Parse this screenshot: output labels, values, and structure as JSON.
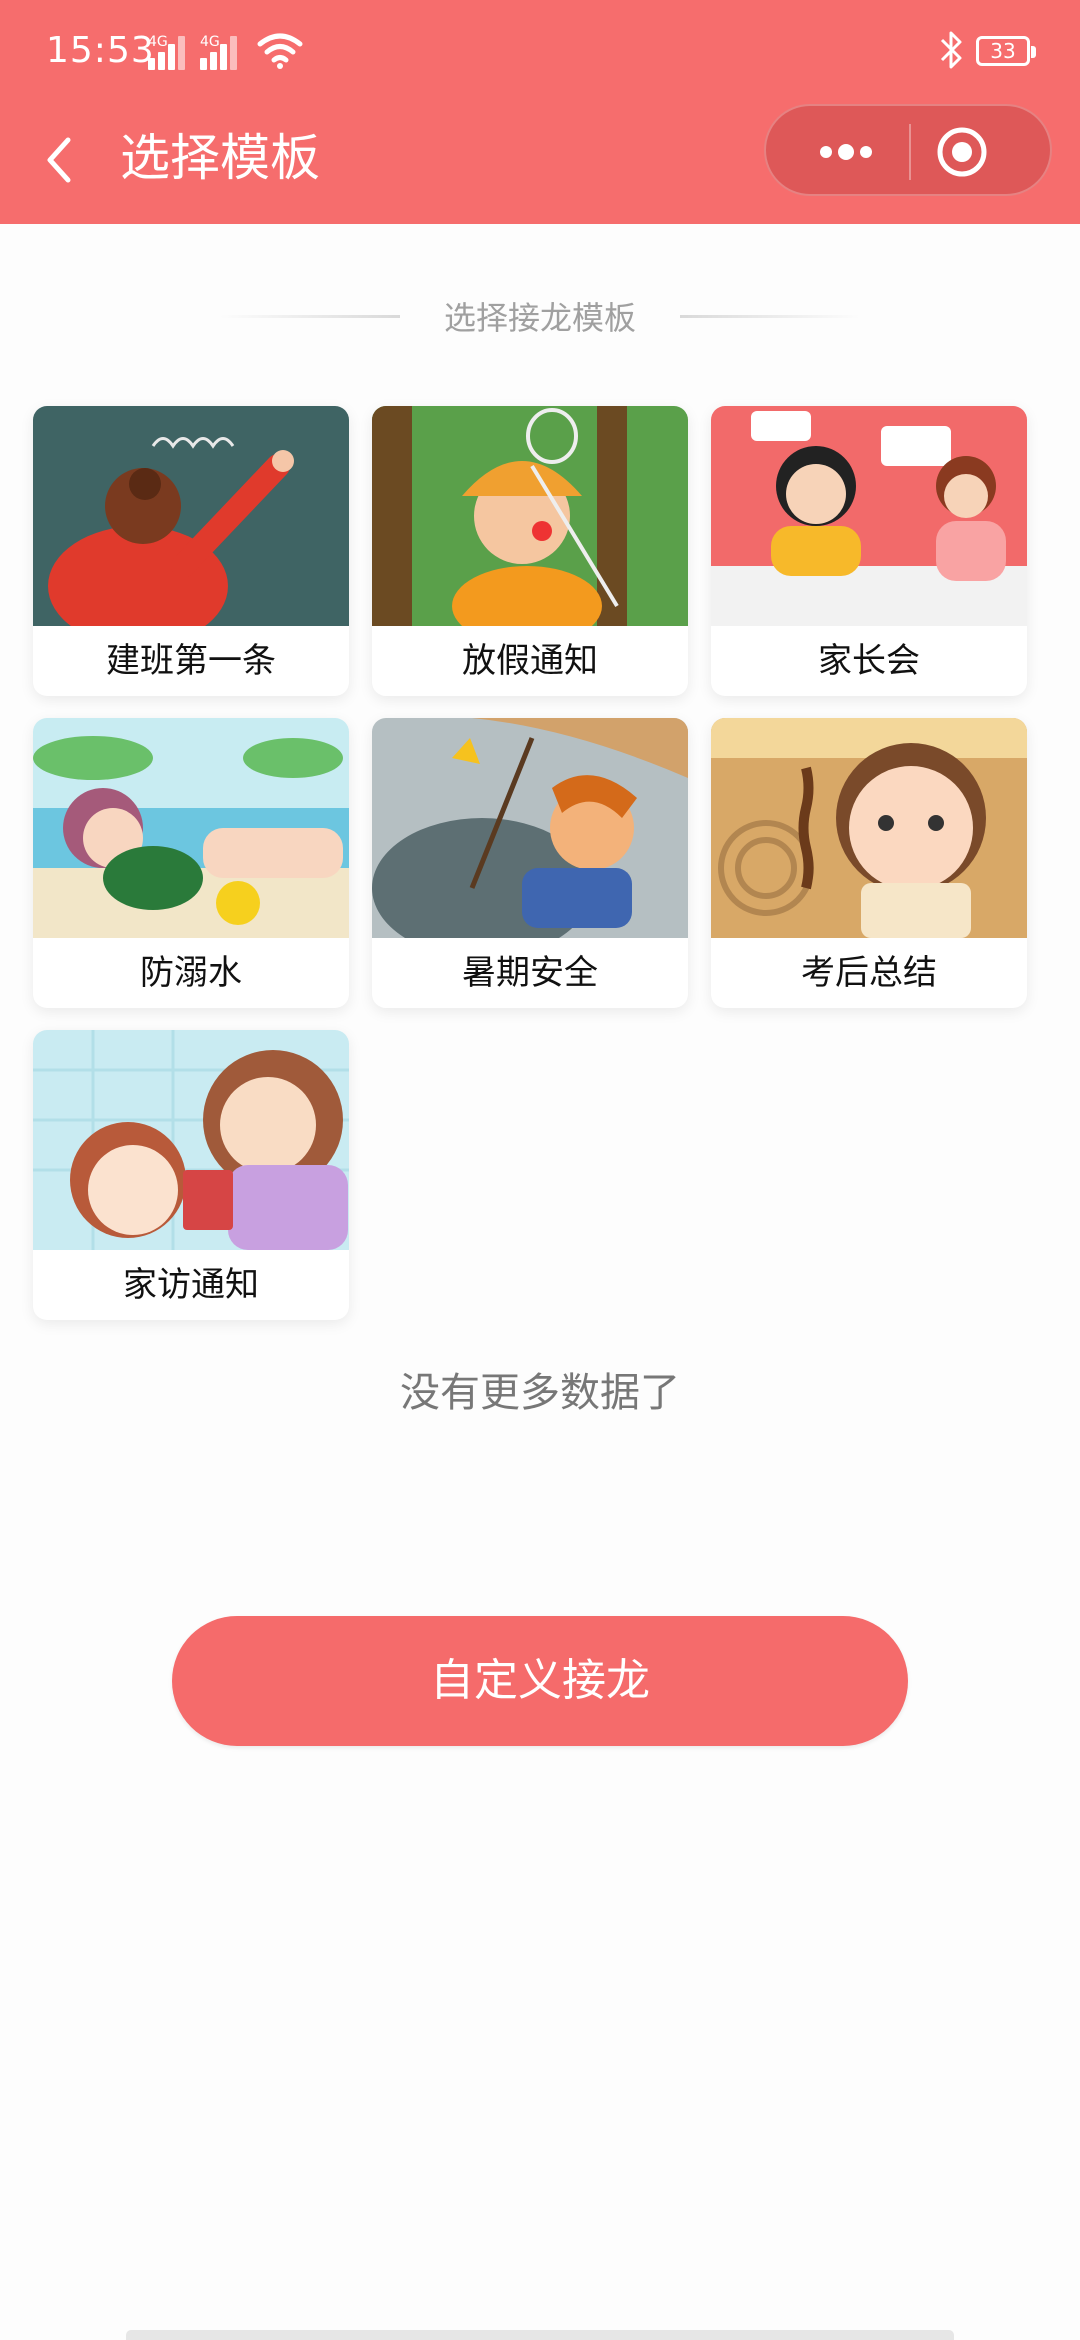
{
  "status_bar": {
    "time": "15:53",
    "signal1_label": "4G",
    "signal2_label": "4G",
    "battery": "33"
  },
  "nav": {
    "title": "选择模板"
  },
  "section": {
    "label": "选择接龙模板"
  },
  "templates": [
    {
      "label": "建班第一条"
    },
    {
      "label": "放假通知"
    },
    {
      "label": "家长会"
    },
    {
      "label": "防溺水"
    },
    {
      "label": "暑期安全"
    },
    {
      "label": "考后总结"
    },
    {
      "label": "家访通知"
    }
  ],
  "footer_note": "没有更多数据了",
  "custom_button": "自定义接龙",
  "colors": {
    "accent": "#f66d6d",
    "capsule": "#de5858"
  }
}
